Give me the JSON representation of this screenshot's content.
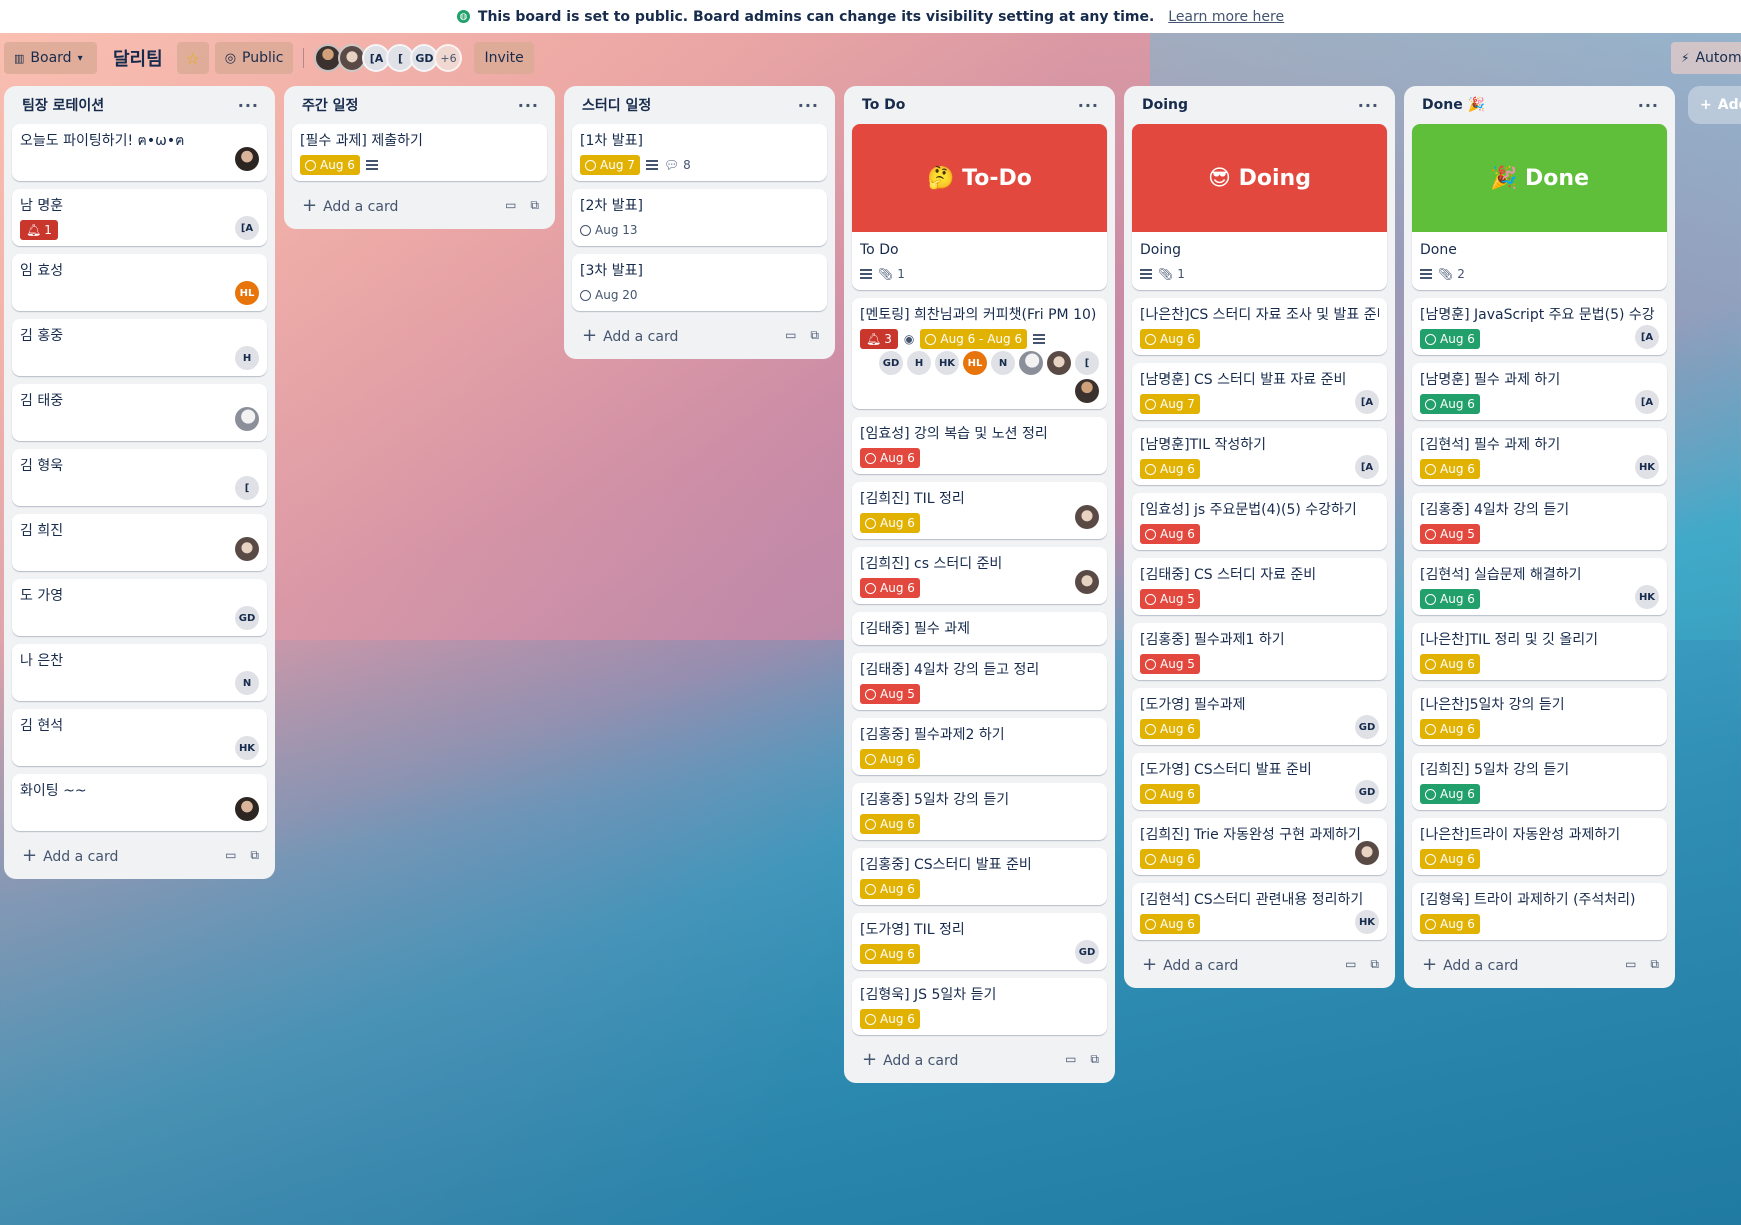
{
  "notice": {
    "message": "This board is set to public. Board admins can change its visibility setting at any time.",
    "link": "Learn more here"
  },
  "header": {
    "view_label": "Board",
    "board_title": "달리팀",
    "visibility_label": "Public",
    "member_initials": [
      "[A",
      "[",
      "GD"
    ],
    "more_members": "+6",
    "invite_label": "Invite",
    "automation_label": "Autom"
  },
  "lists": [
    {
      "title": "팀장 로테이션",
      "cards": [
        {
          "title": "오늘도 파이팅하기! ฅ•ω•ฅ"
        },
        {
          "title": "남 명훈",
          "bell": "1",
          "avatar": "[A"
        },
        {
          "title": "임 효성",
          "avatar": "HL"
        },
        {
          "title": "김 홍중",
          "avatar": "H"
        },
        {
          "title": "김 태중"
        },
        {
          "title": "김 형욱",
          "avatar": "["
        },
        {
          "title": "김 희진"
        },
        {
          "title": "도 가영",
          "avatar": "GD"
        },
        {
          "title": "나 은찬",
          "avatar": "N"
        },
        {
          "title": "김 현석",
          "avatar": "HK"
        },
        {
          "title": "화이팅 ~~"
        }
      ],
      "add_label": "Add a card"
    },
    {
      "title": "주간 일정",
      "cards": [
        {
          "title": "[필수 과제] 제출하기",
          "due": "Aug 6"
        }
      ],
      "add_label": "Add a card"
    },
    {
      "title": "스터디 일정",
      "cards": [
        {
          "title": "[1차 발표]",
          "due": "Aug 7",
          "comments": "8"
        },
        {
          "title": "[2차 발표]",
          "due": "Aug 13"
        },
        {
          "title": "[3차 발표]",
          "due": "Aug 20"
        }
      ],
      "add_label": "Add a card"
    },
    {
      "title": "To Do",
      "cover": "🤔 To-Do",
      "cards": [
        {
          "title": "To Do",
          "attachments": "1"
        },
        {
          "title": "[멘토링] 희찬님과의 커피챗(Fri PM 10)",
          "bell": "3",
          "due": "Aug 6 - Aug 6",
          "members": [
            "GD",
            "H",
            "HK",
            "HL",
            "N",
            "["
          ]
        },
        {
          "title": "[임효성] 강의 복습 및 노션 정리",
          "due": "Aug 6"
        },
        {
          "title": "[김희진] TIL 정리",
          "due": "Aug 6"
        },
        {
          "title": "[김희진] cs 스터디 준비",
          "due": "Aug 6"
        },
        {
          "title": "[김태중] 필수 과제"
        },
        {
          "title": "[김태중] 4일차 강의 듣고 정리",
          "due": "Aug 5"
        },
        {
          "title": "[김홍중] 필수과제2 하기",
          "due": "Aug 6"
        },
        {
          "title": "[김홍중] 5일차 강의 듣기",
          "due": "Aug 6"
        },
        {
          "title": "[김홍중] CS스터디 발표 준비",
          "due": "Aug 6"
        },
        {
          "title": "[도가영] TIL 정리",
          "due": "Aug 6",
          "avatar": "GD"
        },
        {
          "title": "[김형욱] JS 5일차 듣기",
          "due": "Aug 6"
        }
      ],
      "add_label": "Add a card"
    },
    {
      "title": "Doing",
      "cover": "😎 Doing",
      "cards": [
        {
          "title": "Doing",
          "attachments": "1"
        },
        {
          "title": "[나은찬]CS 스터디 자료 조사 및 발표 준비",
          "due": "Aug 6"
        },
        {
          "title": "[남명훈] CS 스터디 발표 자료 준비",
          "due": "Aug 7",
          "avatar": "[A"
        },
        {
          "title": "[남명훈]TIL 작성하기",
          "due": "Aug 6",
          "avatar": "[A"
        },
        {
          "title": "[임효성] js 주요문법(4)(5) 수강하기",
          "due": "Aug 6"
        },
        {
          "title": "[김태중] CS 스터디 자료 준비",
          "due": "Aug 5"
        },
        {
          "title": "[김홍중] 필수과제1 하기",
          "due": "Aug 5"
        },
        {
          "title": "[도가영] 필수과제",
          "due": "Aug 6",
          "avatar": "GD"
        },
        {
          "title": "[도가영] CS스터디 발표 준비",
          "due": "Aug 6",
          "avatar": "GD"
        },
        {
          "title": "[김희진] Trie 자동완성 구현 과제하기",
          "due": "Aug 6"
        },
        {
          "title": "[김현석] CS스터디 관련내용 정리하기",
          "due": "Aug 6",
          "avatar": "HK"
        }
      ],
      "add_label": "Add a card"
    },
    {
      "title": "Done 🎉",
      "cover": "🎉 Done",
      "cards": [
        {
          "title": "Done",
          "attachments": "2"
        },
        {
          "title": "[남명훈] JavaScript 주요 문법(5) 수강",
          "due": "Aug 6",
          "avatar": "[A"
        },
        {
          "title": "[남명훈] 필수 과제 하기",
          "due": "Aug 6",
          "avatar": "[A"
        },
        {
          "title": "[김현석] 필수 과제 하기",
          "due": "Aug 6",
          "avatar": "HK"
        },
        {
          "title": "[김홍중] 4일차 강의 듣기",
          "due": "Aug 5"
        },
        {
          "title": "[김현석] 실습문제 해결하기",
          "due": "Aug 6",
          "avatar": "HK"
        },
        {
          "title": "[나은찬]TIL 정리 및 깃 올리기",
          "due": "Aug 6"
        },
        {
          "title": "[나은찬]5일차 강의 듣기",
          "due": "Aug 6"
        },
        {
          "title": "[김희진] 5일차 강의 듣기",
          "due": "Aug 6"
        },
        {
          "title": "[나은찬]트라이 자동완성 과제하기",
          "due": "Aug 6"
        },
        {
          "title": "[김형욱] 트라이 과제하기 (주석처리)",
          "due": "Aug 6"
        }
      ],
      "add_label": "Add a card"
    }
  ],
  "add_list_label": "Add",
  "colors": {
    "due_yellow": "#e2b203",
    "due_red": "#e2483d",
    "due_green": "#22a06b",
    "cover_red": "#e2483d",
    "cover_green": "#5fbf3a",
    "avatar_orange": "#e8740c"
  }
}
